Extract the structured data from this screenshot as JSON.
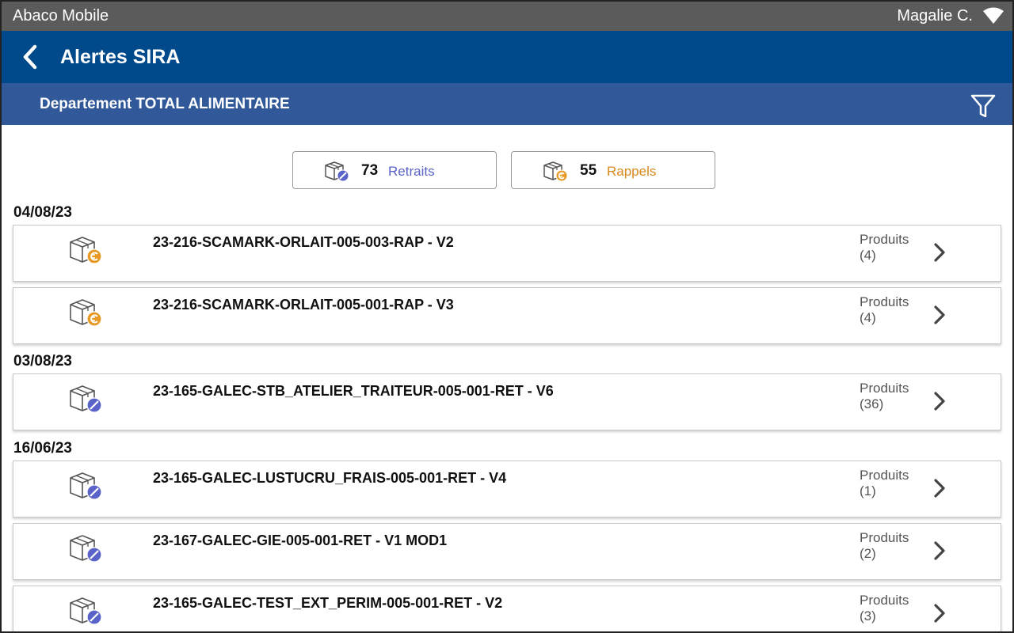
{
  "status_bar": {
    "app_name": "Abaco Mobile",
    "user": "Magalie C.",
    "wifi_icon": "wifi-icon"
  },
  "header": {
    "back_icon": "chevron-left-icon",
    "title": "Alertes SIRA"
  },
  "department": {
    "label": "Departement TOTAL ALIMENTAIRE",
    "filter_icon": "funnel-icon"
  },
  "counters": {
    "retraits": {
      "count": "73",
      "label": "Retraits",
      "icon": "box-retrait-icon"
    },
    "rappels": {
      "count": "55",
      "label": "Rappels",
      "icon": "box-rappel-icon"
    }
  },
  "groups": [
    {
      "date": "04/08/23",
      "items": [
        {
          "name": "23-216-SCAMARK-ORLAIT-005-003-RAP - V2",
          "kind": "rappel",
          "products_label": "Produits",
          "products_count": "(4)"
        },
        {
          "name": "23-216-SCAMARK-ORLAIT-005-001-RAP - V3",
          "kind": "rappel",
          "products_label": "Produits",
          "products_count": "(4)"
        }
      ]
    },
    {
      "date": "03/08/23",
      "items": [
        {
          "name": "23-165-GALEC-STB_ATELIER_TRAITEUR-005-001-RET - V6",
          "kind": "retrait",
          "products_label": "Produits",
          "products_count": "(36)"
        }
      ]
    },
    {
      "date": "16/06/23",
      "items": [
        {
          "name": "23-165-GALEC-LUSTUCRU_FRAIS-005-001-RET - V4",
          "kind": "retrait",
          "products_label": "Produits",
          "products_count": "(1)"
        },
        {
          "name": "23-167-GALEC-GIE-005-001-RET - V1 MOD1",
          "kind": "retrait",
          "products_label": "Produits",
          "products_count": "(2)"
        },
        {
          "name": "23-165-GALEC-TEST_EXT_PERIM-005-001-RET - V2",
          "kind": "retrait",
          "products_label": "Produits",
          "products_count": "(3)"
        }
      ]
    }
  ],
  "colors": {
    "status_bar": "#5b5b5b",
    "app_bar": "#004a8c",
    "department_bar": "#31599a",
    "retrait_accent": "#5a63c8",
    "rappel_accent": "#d88a1d"
  }
}
